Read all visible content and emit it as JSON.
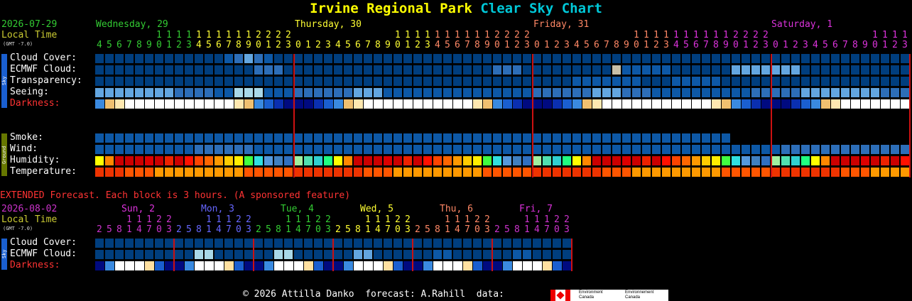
{
  "title": {
    "park": "Irvine Regional Park",
    "chart": "Clear Sky Chart"
  },
  "main": {
    "date": "2026-07-29",
    "local_time": "Local Time",
    "gmt": "(GMT -7.0)",
    "days": [
      {
        "label": "Wednesday, 29",
        "color": "#33cc33"
      },
      {
        "label": "Thursday, 30",
        "color": "#ffff33"
      },
      {
        "label": "Friday, 31",
        "color": "#ff8866"
      },
      {
        "label": "Saturday, 1",
        "color": "#dd33dd"
      }
    ],
    "hour_tens": [
      "1111111222",
      "11111111112222",
      "11111111112222",
      "11111111112222"
    ],
    "hour_ones": [
      "4567890123",
      "0123456789012345678901230123456789012345678901230123456789012345678901230123456789012345678901 23"
    ],
    "sky_side_label": "Sky",
    "ground_side_label": "Ground",
    "rows": {
      "cloud": "Cloud Cover:",
      "ecmwf": "ECMWF Cloud:",
      "transparency": "Transparency:",
      "seeing": "Seeing:",
      "darkness": "Darkness:",
      "smoke": "Smoke:",
      "wind": "Wind:",
      "humidity": "Humidity:",
      "temperature": "Temperature:"
    }
  },
  "extended": {
    "heading": "EXTENDED Forecast. Each block is 3 hours. (A sponsored feature)",
    "date": "2026-08-02",
    "local_time": "Local Time",
    "gmt": "(GMT -7.0)",
    "days": [
      {
        "label": "Sun, 2",
        "color": "#dd33dd"
      },
      {
        "label": "Mon, 3",
        "color": "#6666ff"
      },
      {
        "label": "Tue, 4",
        "color": "#33cc33"
      },
      {
        "label": "Wed, 5",
        "color": "#ffff33"
      },
      {
        "label": "Fri, 7",
        "color": "#dd33dd"
      }
    ],
    "thu_label": "Thu, 6",
    "thu_color": "#ff8866",
    "hour_tens": "11122",
    "hour_ones": "25814703",
    "rows": {
      "cloud": "Cloud Cover:",
      "ecmwf": "ECMWF Cloud:",
      "darkness": "Darkness:"
    }
  },
  "footer": {
    "copyright": "© 2026 Attilla Danko",
    "forecast": "forecast: A.Rahill",
    "data": "data:",
    "env1": "Environment Canada",
    "env2": "Environnement Canada"
  },
  "colors": {
    "deep_blue": "#003e7e",
    "mid_blue": "#0d58a6",
    "blue": "#2d6eb8",
    "light_blue": "#63a6e0",
    "pale": "#a9d8e8",
    "grid_red": "#cc1111"
  }
}
